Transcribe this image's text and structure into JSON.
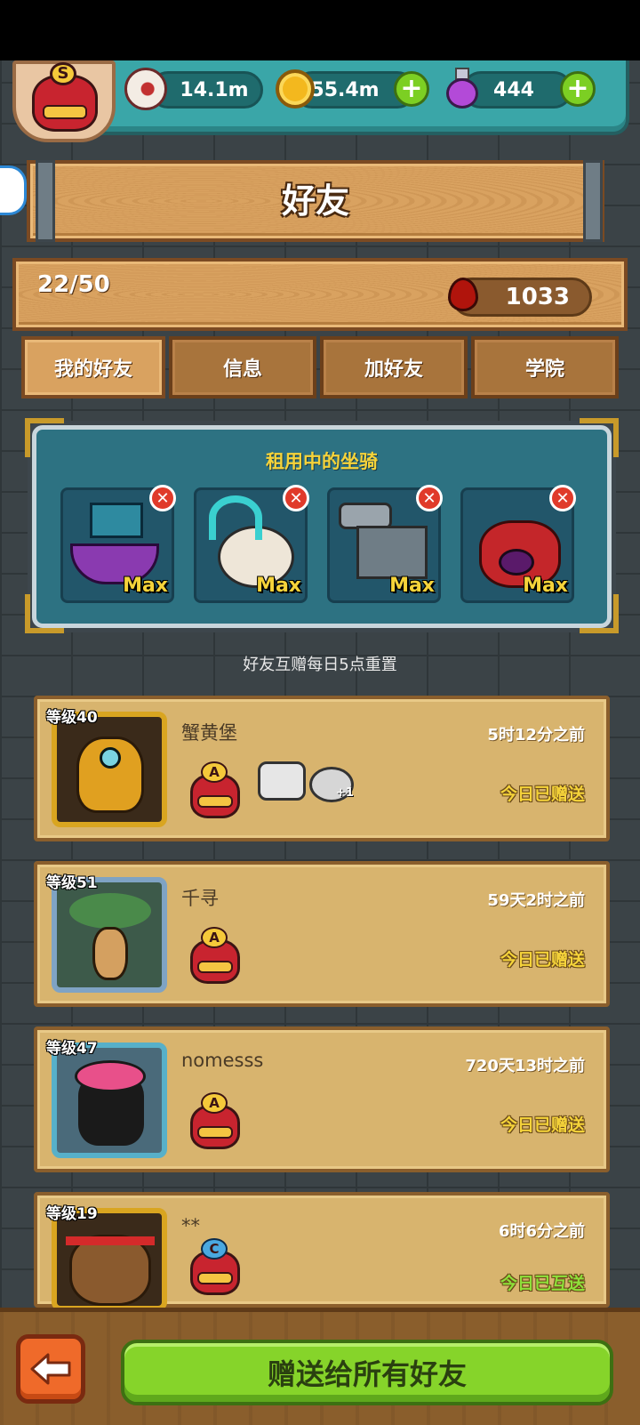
{
  "resources": {
    "eyeball": {
      "icon": "eyeball-icon",
      "value": "14.1m"
    },
    "coins": {
      "icon": "coin-icon",
      "value": "55.4m"
    },
    "potion": {
      "icon": "potion-icon",
      "value": "444"
    }
  },
  "player_rank": "S",
  "title": "好友",
  "friend_count": "22/50",
  "blood_points": "1033",
  "tabs": [
    {
      "label": "我的好友",
      "active": true
    },
    {
      "label": "信息",
      "active": false
    },
    {
      "label": "加好友",
      "active": false
    },
    {
      "label": "学院",
      "active": false
    }
  ],
  "rented_mounts": {
    "title": "租用中的坐骑",
    "items": [
      {
        "name": "viking-ship-mount",
        "level_label": "Max"
      },
      {
        "name": "octopus-snail-mount",
        "level_label": "Max"
      },
      {
        "name": "cannon-tank-mount",
        "level_label": "Max"
      },
      {
        "name": "red-demon-mount",
        "level_label": "Max"
      }
    ]
  },
  "reset_note": "好友互赠每日5点重置",
  "friends": [
    {
      "level": "等级40",
      "name": "蟹黄堡",
      "last_seen": "5时12分之前",
      "rank": "A",
      "status": "今日已赠送",
      "mutual": false,
      "extra_badge": "+1",
      "frame_color": "#d9a520",
      "bg": "#3a2a1a"
    },
    {
      "level": "等级51",
      "name": "千寻",
      "last_seen": "59天2时之前",
      "rank": "A",
      "status": "今日已赠送",
      "mutual": false,
      "extra_badge": "",
      "frame_color": "#7fa3c4",
      "bg": "#3d5a4a"
    },
    {
      "level": "等级47",
      "name": "nomesss",
      "last_seen": "720天13时之前",
      "rank": "A",
      "status": "今日已赠送",
      "mutual": false,
      "extra_badge": "",
      "frame_color": "#57b0c9",
      "bg": "#4a6a7a"
    },
    {
      "level": "等级19",
      "name": "**",
      "last_seen": "6时6分之前",
      "rank": "C",
      "status": "今日已互送",
      "mutual": true,
      "extra_badge": "",
      "frame_color": "#d9a520",
      "bg": "#3a2a1a"
    }
  ],
  "bottom": {
    "back_icon": "arrow-left-icon",
    "gift_all_label": "赠送给所有好友"
  }
}
